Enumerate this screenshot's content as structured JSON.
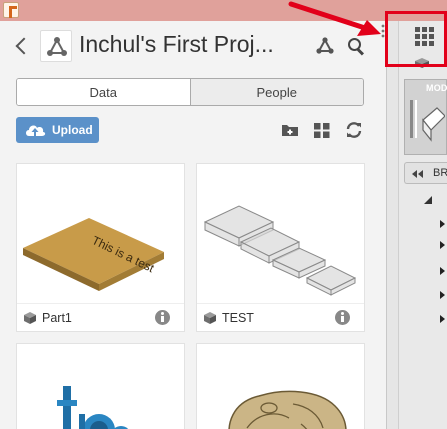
{
  "header": {
    "title": "Inchul's First Proj..."
  },
  "tabs": {
    "data_label": "Data",
    "people_label": "People"
  },
  "toolbar": {
    "upload_label": "Upload"
  },
  "files": [
    {
      "name": "Part1"
    },
    {
      "name": "TEST"
    }
  ],
  "thumbnails": {
    "part1_engraving": "This is a test"
  },
  "browser": {
    "model_label": "MOD",
    "breadcrumb_label": "BR"
  },
  "colors": {
    "accent": "#5b91c9",
    "titlebar": "#e0a19b",
    "annotation": "#e2001a"
  }
}
